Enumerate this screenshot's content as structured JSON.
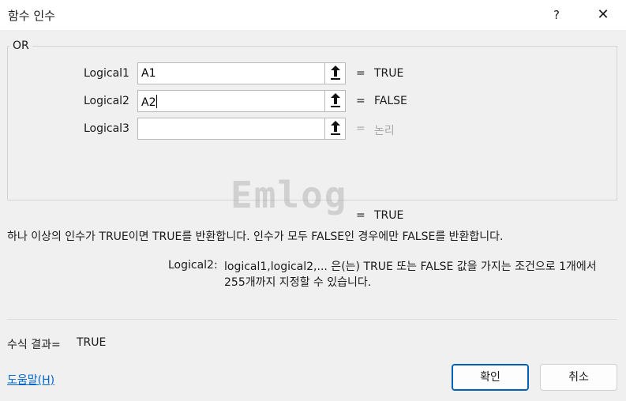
{
  "window": {
    "title": "함수 인수",
    "help_glyph": "?",
    "close_glyph": "✕"
  },
  "function_name": "OR",
  "args": [
    {
      "label": "Logical1",
      "value": "A1",
      "result": "TRUE",
      "result_color": "#1a1a1a"
    },
    {
      "label": "Logical2",
      "value": "A2",
      "result": "FALSE",
      "result_color": "#1a1a1a"
    },
    {
      "label": "Logical3",
      "value": "",
      "result": "논리",
      "result_color": "#a8a8a8"
    }
  ],
  "equals": "=",
  "watermark": "Emlog",
  "function_result": "TRUE",
  "description": "하나 이상의 인수가 TRUE이면 TRUE를 반환합니다. 인수가 모두 FALSE인 경우에만 FALSE를 반환합니다.",
  "arg_help": {
    "label": "Logical2:",
    "text": "logical1,logical2,... 은(는) TRUE 또는 FALSE 값을 가지는 조건으로 1개에서 255개까지 지정할 수 있습니다."
  },
  "formula_result": {
    "label": "수식 결과=",
    "value": "TRUE"
  },
  "help_link": "도움말(H)",
  "buttons": {
    "ok": "확인",
    "cancel": "취소"
  },
  "colors": {
    "accent": "#005fb8",
    "link": "#0066cc",
    "background": "#f0f0f0"
  },
  "icons": {
    "collapse_dialog": "range-selector-arrow-up-icon"
  }
}
